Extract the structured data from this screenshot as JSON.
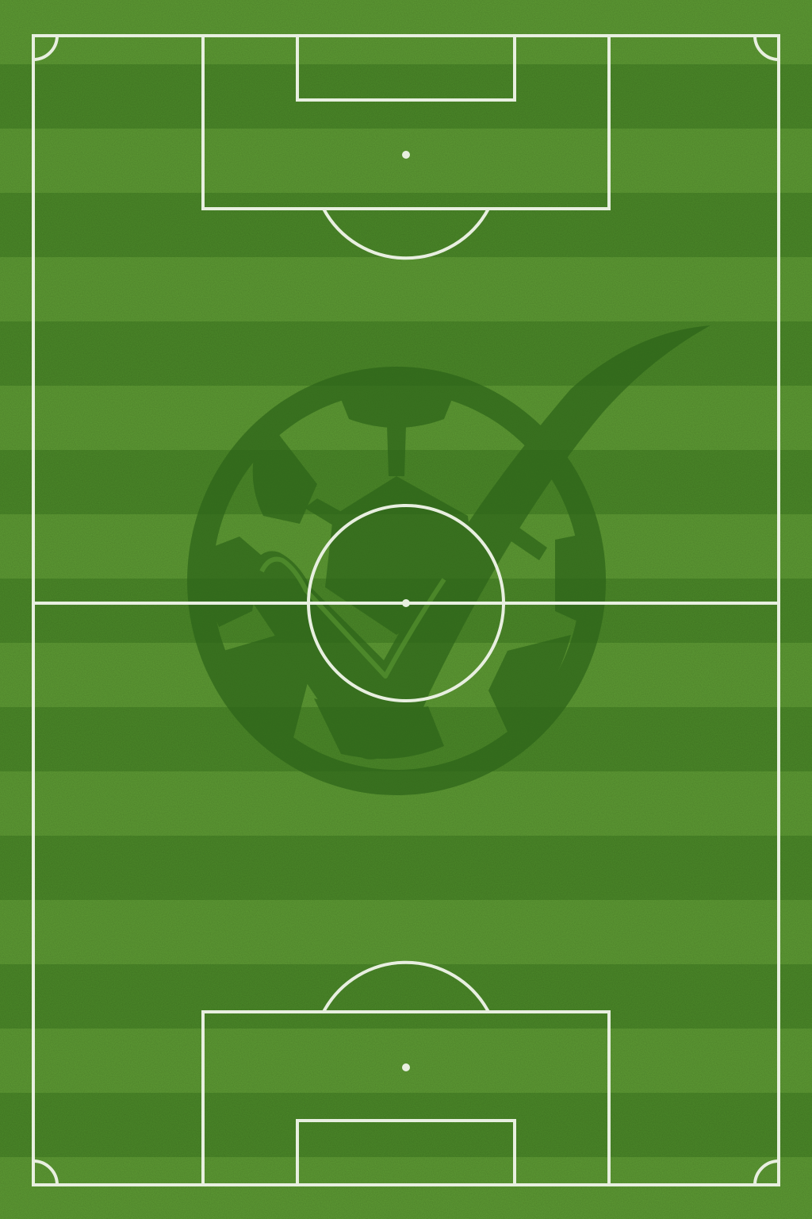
{
  "pitch": {
    "stripe_light": "#5e9c34",
    "stripe_dark": "#4c8a29",
    "line_color": "#e8efe0",
    "orientation": "vertical"
  },
  "watermark": {
    "icon": "soccer-ball-checkmark-icon",
    "color": "#2d6419",
    "opacity": 0.72
  }
}
